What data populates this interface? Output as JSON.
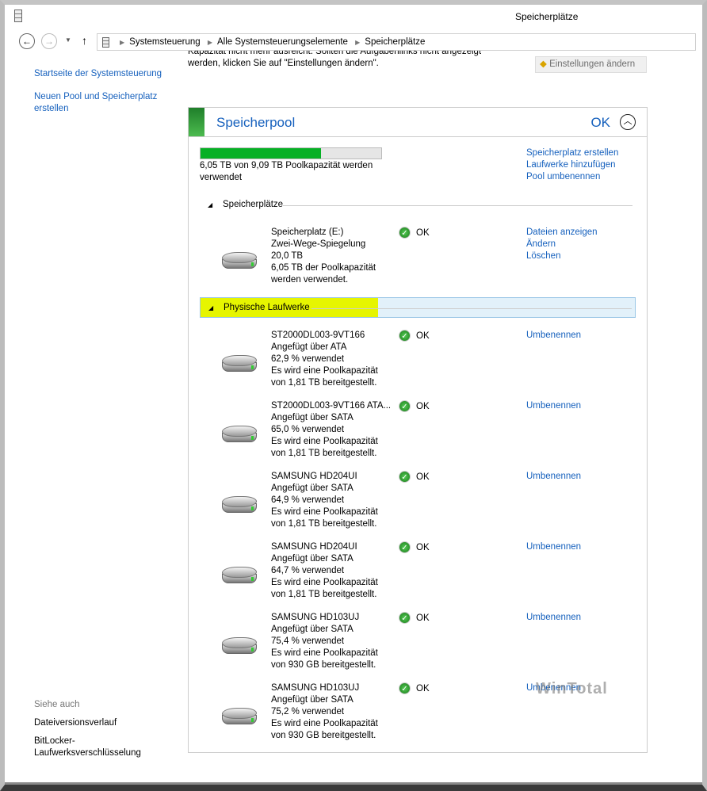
{
  "window": {
    "title": "Speicherplätze"
  },
  "nav": {
    "back": "←",
    "forward": "→",
    "up": "↑",
    "breadcrumb": [
      "Systemsteuerung",
      "Alle Systemsteuerungselemente",
      "Speicherplätze"
    ]
  },
  "intro": {
    "line1": "Kapazität nicht mehr ausreicht. Sollten die Aufgabenlinks nicht angezeigt",
    "line2": "werden, klicken Sie auf \"Einstellungen ändern\".",
    "settings_button": "Einstellungen ändern"
  },
  "sidebar": {
    "links": [
      "Startseite der Systemsteuerung",
      "Neuen Pool und Speicherplatz erstellen"
    ],
    "see_also": "Siehe auch",
    "see_also_links": [
      "Dateiversionsverlauf",
      "BitLocker-Laufwerksverschlüsselung"
    ]
  },
  "pool": {
    "title": "Speicherpool",
    "status": "OK",
    "usage_fraction": 0.666,
    "usage_text": "6,05 TB von 9,09 TB Poolkapazität werden verwendet",
    "actions": [
      "Speicherplatz erstellen",
      "Laufwerke hinzufügen",
      "Pool umbenennen"
    ]
  },
  "spaces": {
    "header": "Speicherplätze",
    "items": [
      {
        "lines": [
          "Speicherplatz (E:)",
          "Zwei-Wege-Spiegelung",
          "20,0 TB",
          "6,05 TB der Poolkapazität",
          "werden verwendet."
        ],
        "status": "OK",
        "actions": [
          "Dateien anzeigen",
          "Ändern",
          "Löschen"
        ]
      }
    ]
  },
  "physical": {
    "header": "Physische Laufwerke",
    "rename": "Umbenennen",
    "items": [
      {
        "lines": [
          "ST2000DL003-9VT166",
          "Angefügt über ATA",
          "62,9 % verwendet",
          "Es wird eine Poolkapazität",
          "von 1,81 TB bereitgestellt."
        ],
        "status": "OK"
      },
      {
        "lines": [
          "ST2000DL003-9VT166 ATA...",
          "Angefügt über SATA",
          "65,0 % verwendet",
          "Es wird eine Poolkapazität",
          "von 1,81 TB bereitgestellt."
        ],
        "status": "OK"
      },
      {
        "lines": [
          "SAMSUNG HD204UI",
          "Angefügt über SATA",
          "64,9 % verwendet",
          "Es wird eine Poolkapazität",
          "von 1,81 TB bereitgestellt."
        ],
        "status": "OK"
      },
      {
        "lines": [
          "SAMSUNG HD204UI",
          "Angefügt über SATA",
          "64,7 % verwendet",
          "Es wird eine Poolkapazität",
          "von 1,81 TB bereitgestellt."
        ],
        "status": "OK"
      },
      {
        "lines": [
          "SAMSUNG HD103UJ",
          "Angefügt über SATA",
          "75,4 % verwendet",
          "Es wird eine Poolkapazität",
          "von 930 GB bereitgestellt."
        ],
        "status": "OK"
      },
      {
        "lines": [
          "SAMSUNG HD103UJ",
          "Angefügt über SATA",
          "75,2 % verwendet",
          "Es wird eine Poolkapazität",
          "von 930 GB bereitgestellt."
        ],
        "status": "OK"
      }
    ]
  },
  "watermark": "WinTotal"
}
